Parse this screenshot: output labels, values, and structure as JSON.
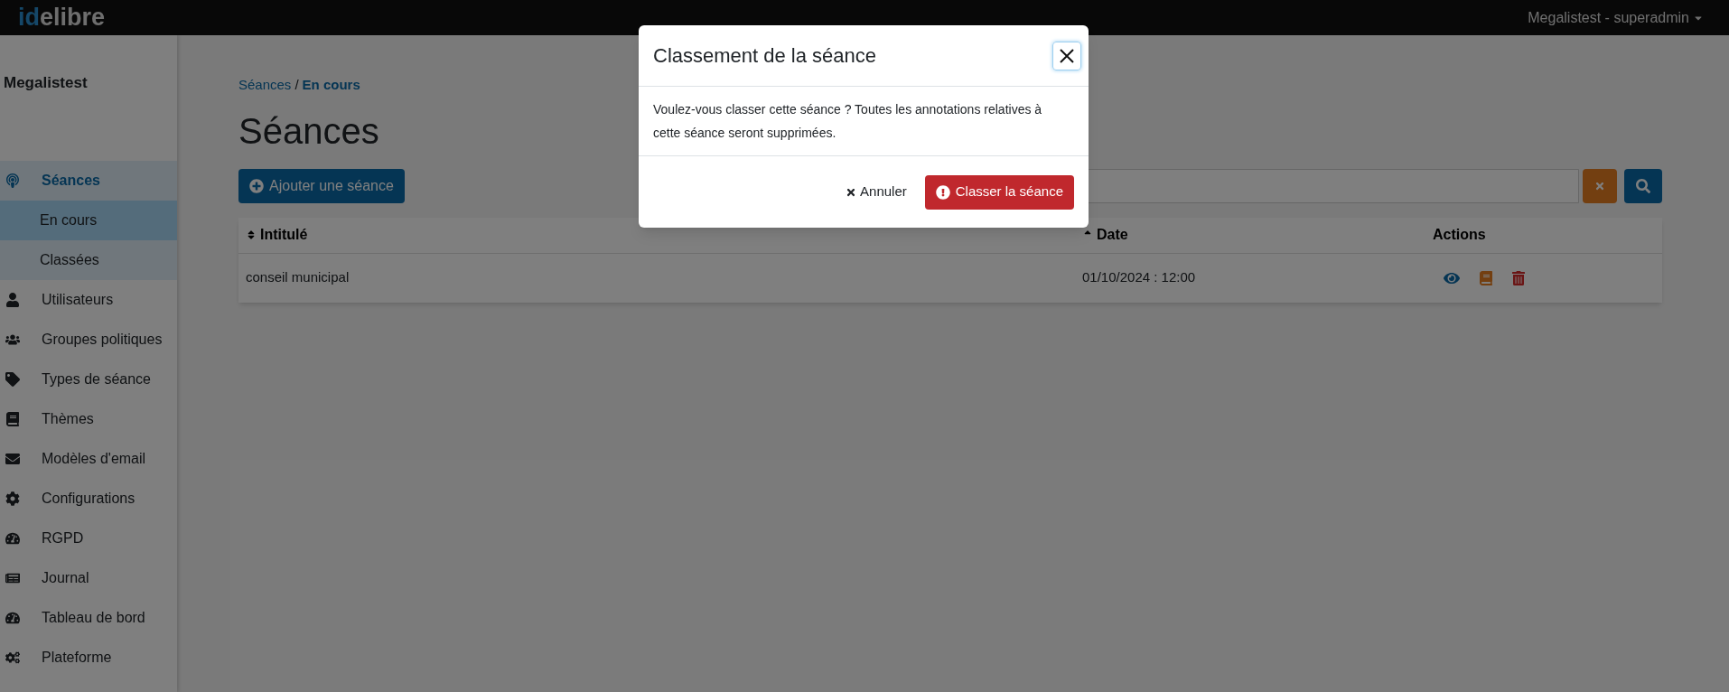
{
  "navbar": {
    "logo_accent": "id",
    "logo_rest": "elibre",
    "user_menu": "Megalistest - superadmin"
  },
  "sidebar": {
    "title": "Megalistest",
    "items": [
      {
        "label": "Séances",
        "selected": true,
        "children": [
          {
            "label": "En cours",
            "selected": true
          },
          {
            "label": "Classées",
            "selected": false
          }
        ]
      },
      {
        "label": "Utilisateurs",
        "selected": false
      },
      {
        "label": "Groupes politiques",
        "selected": false
      },
      {
        "label": "Types de séance",
        "selected": false
      },
      {
        "label": "Thèmes",
        "selected": false
      },
      {
        "label": "Modèles d'email",
        "selected": false
      },
      {
        "label": "Configurations",
        "selected": false
      },
      {
        "label": "RGPD",
        "selected": false
      },
      {
        "label": "Journal",
        "selected": false
      },
      {
        "label": "Tableau de bord",
        "selected": false
      },
      {
        "label": "Plateforme",
        "selected": false
      }
    ]
  },
  "breadcrumb": [
    {
      "label": "Séances",
      "current": false
    },
    {
      "label": "En cours",
      "current": true
    }
  ],
  "breadcrumb_separator": "/",
  "page_title": "Séances",
  "add_button": "Ajouter une séance",
  "table": {
    "columns": [
      {
        "label": "Intitulé",
        "sortable": true,
        "sorted": false
      },
      {
        "label": "Date",
        "sortable": true,
        "sorted": true
      },
      {
        "label": "Actions",
        "sortable": false
      }
    ],
    "rows": [
      {
        "title": "conseil municipal",
        "date": "01/10/2024 : 12:00"
      }
    ]
  },
  "modal": {
    "title": "Classement de la séance",
    "message": "Voulez-vous classer cette séance ? Toutes les annotations relatives à cette séance seront supprimées.",
    "cancel": "Annuler",
    "confirm": "Classer la séance"
  }
}
